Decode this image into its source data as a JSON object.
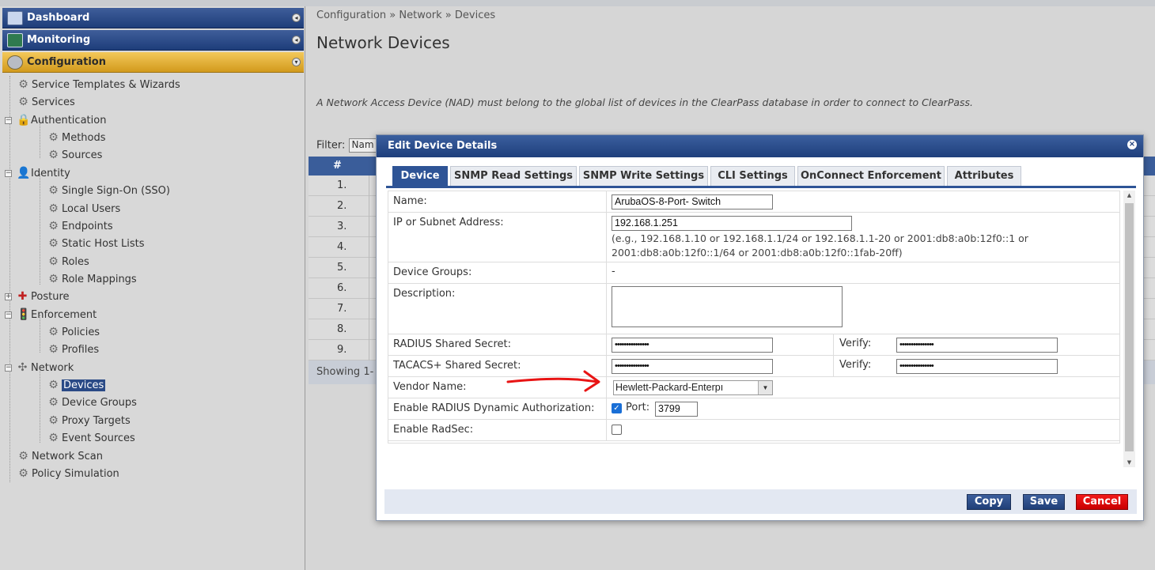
{
  "sidebar": {
    "headers": {
      "dashboard": "Dashboard",
      "monitoring": "Monitoring",
      "configuration": "Configuration"
    },
    "tree": {
      "service_templates": "Service Templates & Wizards",
      "services": "Services",
      "authentication": "Authentication",
      "methods": "Methods",
      "sources": "Sources",
      "identity": "Identity",
      "sso": "Single Sign-On (SSO)",
      "local_users": "Local Users",
      "endpoints": "Endpoints",
      "static_host_lists": "Static Host Lists",
      "roles": "Roles",
      "role_mappings": "Role Mappings",
      "posture": "Posture",
      "enforcement": "Enforcement",
      "policies": "Policies",
      "profiles": "Profiles",
      "network": "Network",
      "devices": "Devices",
      "device_groups": "Device Groups",
      "proxy_targets": "Proxy Targets",
      "event_sources": "Event Sources",
      "network_scan": "Network Scan",
      "policy_simulation": "Policy Simulation"
    }
  },
  "main": {
    "breadcrumb": "Configuration » Network » Devices",
    "title": "Network Devices",
    "description": "A Network Access Device (NAD) must belong to the global list of devices in the ClearPass database in order to connect to ClearPass.",
    "filter_label": "Filter:",
    "filter_value": "Nam",
    "grid_header": "#",
    "rows": [
      "1.",
      "2.",
      "3.",
      "4.",
      "5.",
      "6.",
      "7.",
      "8.",
      "9."
    ],
    "footer": "Showing 1-"
  },
  "modal": {
    "title": "Edit Device Details",
    "tabs": [
      "Device",
      "SNMP Read Settings",
      "SNMP Write Settings",
      "CLI Settings",
      "OnConnect Enforcement",
      "Attributes"
    ],
    "fields": {
      "name_label": "Name:",
      "name_value": "ArubaOS-8-Port- Switch",
      "ip_label": "IP or Subnet Address:",
      "ip_value": "192.168.1.251",
      "ip_hint": "(e.g., 192.168.1.10 or 192.168.1.1/24 or 192.168.1.1-20 or 2001:db8:a0b:12f0::1 or 2001:db8:a0b:12f0::1/64 or 2001:db8:a0b:12f0::1fab-20ff)",
      "groups_label": "Device Groups:",
      "groups_value": "-",
      "description_label": "Description:",
      "radius_label": "RADIUS Shared Secret:",
      "radius_value": "•••••••••••••••",
      "radius_verify_label": "Verify:",
      "radius_verify_value": "•••••••••••••••",
      "tacacs_label": "TACACS+ Shared Secret:",
      "tacacs_value": "•••••••••••••••",
      "tacacs_verify_label": "Verify:",
      "tacacs_verify_value": "•••••••••••••••",
      "vendor_label": "Vendor Name:",
      "vendor_value": "Hewlett-Packard-Enterpı",
      "coa_label": "Enable RADIUS Dynamic Authorization:",
      "coa_checked": true,
      "port_label": "Port:",
      "port_value": "3799",
      "radsec_label": "Enable RadSec:",
      "radsec_checked": false
    },
    "buttons": {
      "copy": "Copy",
      "save": "Save",
      "cancel": "Cancel"
    }
  },
  "colors": {
    "nav_blue": "#1e3d7a",
    "accent_gold": "#d29a1c",
    "tab_blue": "#2e5496",
    "cancel_red": "#c90000",
    "annotation_red": "#e81414"
  },
  "icons": {
    "gear": "gear-icon",
    "lock": "lock-icon",
    "user": "user-icon",
    "posture": "shield-icon",
    "traffic": "traffic-light-icon",
    "network": "network-icon"
  }
}
